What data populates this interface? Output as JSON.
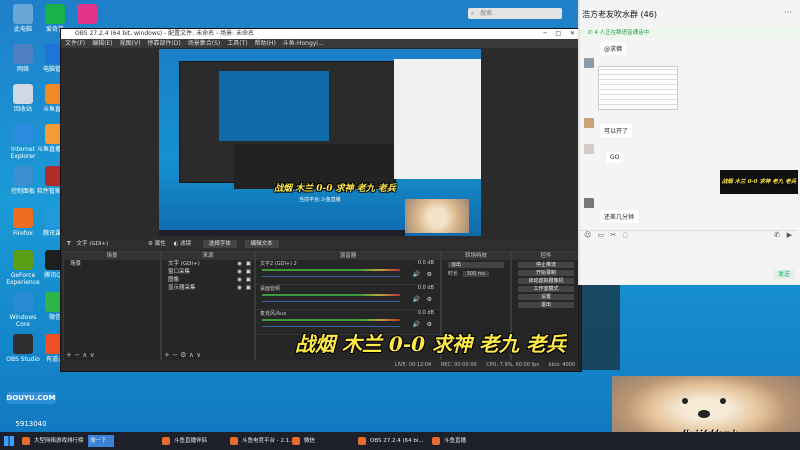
{
  "desktop": {
    "icons": [
      {
        "label": "此电脑",
        "color": "#6aa7d8"
      },
      {
        "label": "爱奇艺",
        "color": "#18b14a"
      },
      {
        "label": "",
        "color": "#e6338a"
      },
      {
        "label": "网络",
        "color": "#4e7fc0"
      },
      {
        "label": "电脑管家",
        "color": "#1e74d8"
      },
      {
        "label": "回收站",
        "color": "#cfd8e3"
      },
      {
        "label": "斗鱼直播",
        "color": "#f08a24"
      },
      {
        "label": "Internet Explorer",
        "color": "#2b8be0"
      },
      {
        "label": "斗鱼直播伴侣",
        "color": "#f39c34"
      },
      {
        "label": "控制面板",
        "color": "#3b8ed0"
      },
      {
        "label": "软件管家Plus",
        "color": "#b22b2b"
      },
      {
        "label": "Firefox",
        "color": "#ef6b1f"
      },
      {
        "label": "腾讯课堂",
        "color": "#2299dd"
      },
      {
        "label": "GeForce Experience",
        "color": "#5aa016"
      },
      {
        "label": "腾讯QQ",
        "color": "#1f1f1f"
      },
      {
        "label": "Windows Core",
        "color": "#2a8ad2"
      },
      {
        "label": "微信",
        "color": "#2fb44b"
      },
      {
        "label": "OBS Studio",
        "color": "#2e2e2e"
      },
      {
        "label": "有道云",
        "color": "#ef5125"
      }
    ],
    "watermark_logo": "DOUYU.COM",
    "watermark_id": "5913040"
  },
  "obs": {
    "title": "OBS 27.2.4 (64 bit, windows) - 配置文件: 未命名 - 场景: 未命名",
    "menu": [
      "文件(F)",
      "编辑(E)",
      "视图(V)",
      "停靠部件(D)",
      "场景集合(S)",
      "工具(T)",
      "帮助(H)",
      "斗鱼-Hongyi..."
    ],
    "source_toolbar": {
      "source": "文字 (GDI+)",
      "prop": "属性",
      "filter": "滤镜",
      "select": "选择字体",
      "edit": "编辑文本"
    },
    "panels": {
      "scenes": "场景",
      "sources": "来源",
      "mixer": "混音器",
      "transitions": "转场特效",
      "controls": "控件"
    },
    "scenes": [
      "场景"
    ],
    "sources": [
      "文字 (GDI+)",
      "窗口采集",
      "图像",
      "显示器采集"
    ],
    "mixer": [
      {
        "name": "文字2 (GDI+) 2",
        "level": "0.0 dB"
      },
      {
        "name": "桌面音频",
        "level": "0.0 dB"
      },
      {
        "name": "麦克风/Aux",
        "level": "0.0 dB"
      }
    ],
    "transition": {
      "type": "淡出",
      "duration_label": "时长",
      "duration": "300 ms"
    },
    "controls": [
      "停止推流",
      "开始录制",
      "启动虚拟摄像机",
      "工作室模式",
      "设置",
      "退出"
    ],
    "status": {
      "live": "LIVE: 00:12:04",
      "rec": "REC: 00:00:00",
      "cpu": "CPU: 7.9%, 60.00 fps",
      "kbps": "kb/s: 4000"
    },
    "preview_caption": "战烟 木兰 0-0 求神 老九 老兵",
    "preview_sub": "当前平台:斗鱼直播"
  },
  "chat": {
    "search_placeholder": "搜索",
    "group_title": "浩方老友吹水群 (46)",
    "voice_banner": "4 人正在群语音通话中",
    "messages": [
      {
        "text": "@求佛"
      },
      {
        "text": "可以开了"
      },
      {
        "text": "GO"
      },
      {
        "text": "还差几分钟"
      }
    ],
    "sticker_text": "战烟 木兰 0-0 求神 老九 老兵",
    "send_label": "发送"
  },
  "overlay": {
    "caption": "战烟 木兰 0-0 求神 老九 老兵",
    "meme_text": "你说的对"
  },
  "taskbar": {
    "search": "搜一下",
    "items": [
      "大型网络游戏排行榜",
      "斗鱼直播伴侣",
      "斗鱼电竞平台 - 2.1...",
      "微信",
      "OBS 27.2.4 (64 bi...",
      "斗鱼直播"
    ]
  }
}
